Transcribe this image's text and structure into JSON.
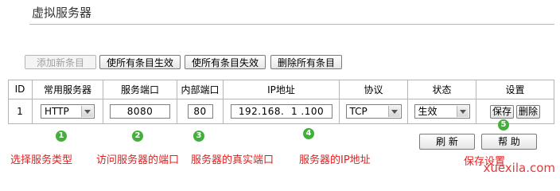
{
  "page": {
    "title": "虚拟服务器"
  },
  "toolbar": {
    "add_label": "添加新条目",
    "enable_all_label": "使所有条目生效",
    "disable_all_label": "使所有条目失效",
    "delete_all_label": "删除所有条目"
  },
  "table": {
    "headers": [
      "ID",
      "常用服务器",
      "服务端口",
      "内部端口",
      "IP地址",
      "协议",
      "状态",
      "设置"
    ],
    "row": {
      "id": "1",
      "service": "HTTP",
      "service_port": "8080",
      "internal_port": "80",
      "ip": "192.168.  1 .100",
      "protocol": "TCP",
      "status": "生效",
      "save_label": "保存",
      "delete_label": "删除"
    }
  },
  "bottom": {
    "refresh_label": "刷 新",
    "help_label": "帮 助"
  },
  "annotations": [
    {
      "num": "1",
      "text": "选择服务类型"
    },
    {
      "num": "2",
      "text": "访问服务器的端口"
    },
    {
      "num": "3",
      "text": "服务器的真实端口"
    },
    {
      "num": "4",
      "text": "服务器的IP地址"
    },
    {
      "num": "5",
      "text": "保存设置"
    }
  ],
  "watermark": "xuexila.com",
  "colors": {
    "accent_green": "#42b03a",
    "annotation_red": "#e01f1f",
    "border": "#b5b5b5"
  }
}
